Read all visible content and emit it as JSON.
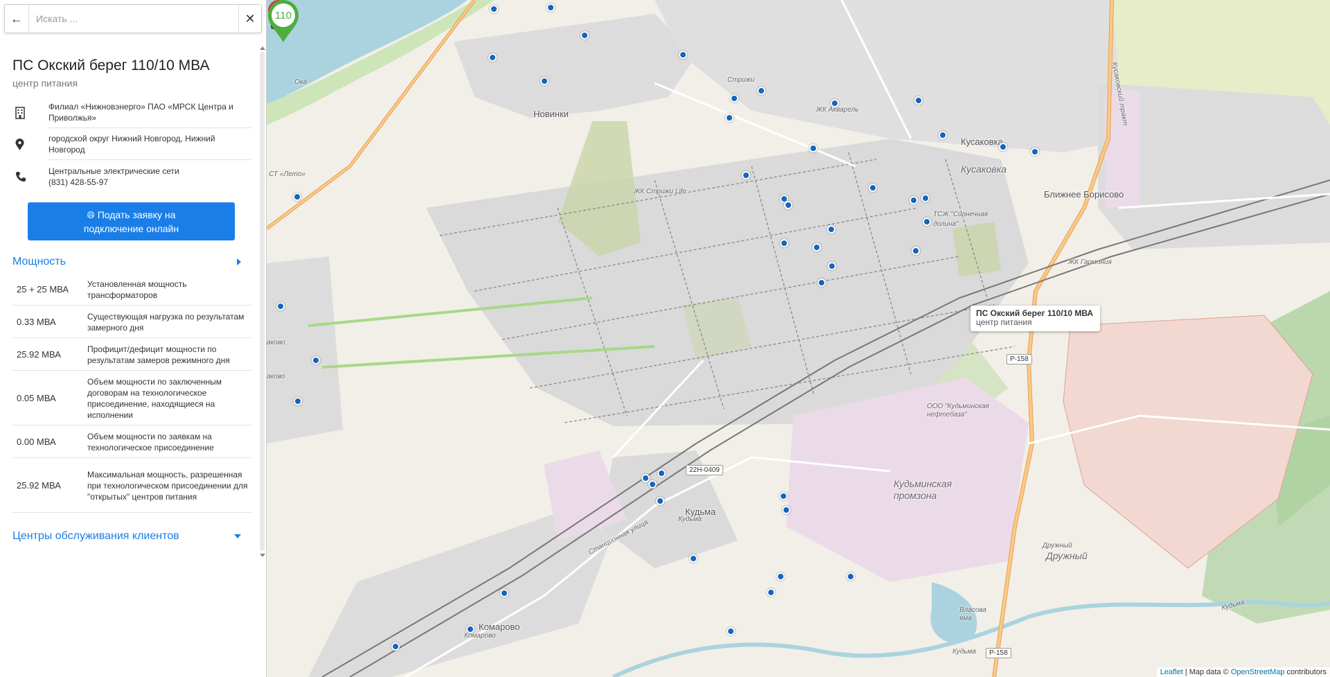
{
  "search": {
    "placeholder": "Искать ...",
    "back_icon": "arrow-left-icon",
    "clear_icon": "close-icon"
  },
  "station": {
    "title": "ПС Окский берег 110/10 МВА",
    "subtitle": "центр питания",
    "owner": "Филиал «Нижновэнерго» ПАО «МРСК Центра и Приволжья»",
    "address": "городской округ Нижний Новгород, Нижний Новгород",
    "network": "Центральные электрические сети",
    "phone": "(831) 428-55-97"
  },
  "apply_button": "Подать заявку на подключение онлайн",
  "power_section": {
    "heading": "Мощность",
    "rows": [
      {
        "value": "25 + 25 МВА",
        "desc": "Установленная мощность трансформаторов"
      },
      {
        "value": "0.33 МВА",
        "desc": "Существующая нагрузка по результатам замерного дня"
      },
      {
        "value": "25.92 МВА",
        "desc": "Профицит/дефицит мощности по результатам замеров режимного дня"
      },
      {
        "value": "0.05 МВА",
        "desc": "Объем мощности по заключенным договорам на технологическое присоединение, находящиеся на исполнении"
      },
      {
        "value": "0.00 МВА",
        "desc": "Объем мощности по заявкам на технологическое присоединение"
      },
      {
        "value": "25.92 МВА",
        "desc": "Максимальная мощность, разрешенная при технологическом присоединении для \"открытых\" центров питания"
      }
    ]
  },
  "service_section": {
    "heading": "Центры обслуживания клиентов"
  },
  "map": {
    "popup_title": "ПС Окский берег 110/10 МВА",
    "popup_subtitle": "центр питания",
    "pin_label_main": "110",
    "pin_label_red": "110",
    "labels": {
      "novinki": "Новинки",
      "strizhi": "Стрижи",
      "akvarel": "ЖК Акварель",
      "kusakovka1": "Кусаковка",
      "kusakovka2": "Кусаковка",
      "blizh": "Ближнее Борисово",
      "strizhi_life": "ЖК Стрижи Life",
      "solnech": "ТСЖ \"Солнечная долина\"",
      "garmonia": "ЖК Гармония",
      "st_leto": "СТ «Лето»",
      "oka": "Ока",
      "neftebaza": "ООО \"Кудьминская нефтебаза\"",
      "promzona": "Кудьминская промзона",
      "kudma1": "Кудьма",
      "kudma2": "Кудьма",
      "druzhny1": "Дружный",
      "druzhny2": "Дружный",
      "komarovo1": "Комарово",
      "komarovo2": "Комарово",
      "stanc": "Станционная улица",
      "vlasova": "Власова яма",
      "kudma_river1": "Кудьма",
      "kudma_river2": "Кудьма",
      "akovo1": "аково",
      "akovo2": "аково",
      "kus_road": "Кусаковский тракт"
    },
    "shields": {
      "r158a": "Р-158",
      "r158b": "Р-158",
      "r22n": "22Н-0409"
    },
    "attribution": {
      "leaflet": "Leaflet",
      "mid": " | Map data © ",
      "osm": "OpenStreetMap",
      "end": " contributors"
    }
  }
}
